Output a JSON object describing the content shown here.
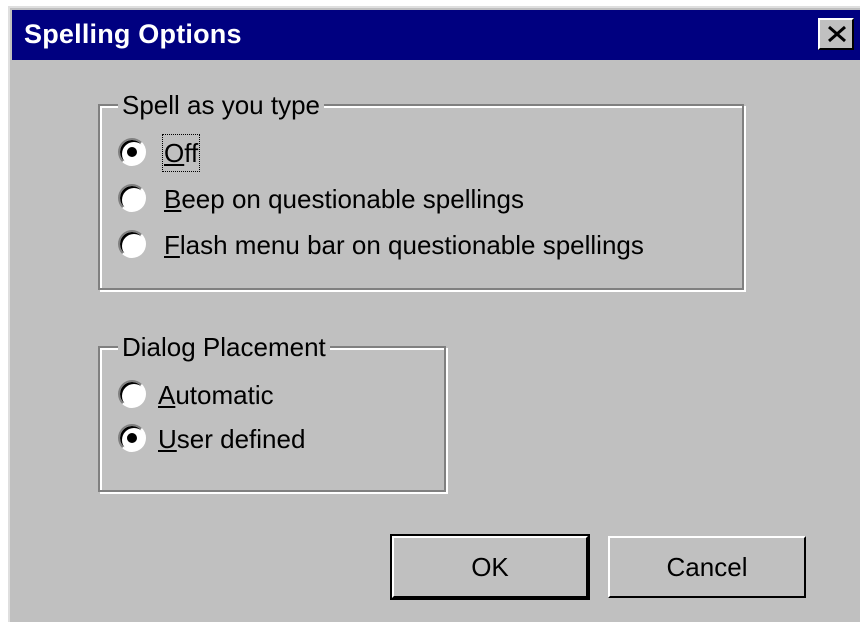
{
  "window": {
    "title": "Spelling Options",
    "close_symbol": "✕"
  },
  "spell_group": {
    "label": "Spell as you type",
    "options": [
      {
        "accel": "O",
        "rest": "ff",
        "selected": true
      },
      {
        "accel": "B",
        "rest": "eep on questionable spellings",
        "selected": false
      },
      {
        "accel": "F",
        "rest": "lash menu bar on questionable spellings",
        "selected": false
      }
    ]
  },
  "placement_group": {
    "label": "Dialog Placement",
    "options": [
      {
        "accel": "A",
        "rest": "utomatic",
        "selected": false
      },
      {
        "accel": "U",
        "rest": "ser defined",
        "selected": true
      }
    ]
  },
  "buttons": {
    "ok_label": "OK",
    "cancel_label": "Cancel"
  },
  "colors": {
    "titlebar": "#000080",
    "face": "#c0c0c0"
  }
}
